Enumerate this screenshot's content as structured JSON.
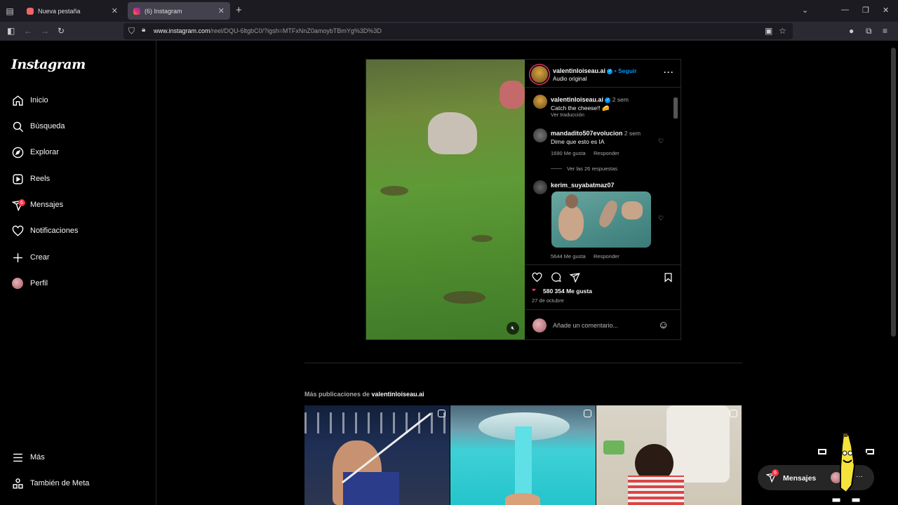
{
  "browser": {
    "tabs": [
      {
        "title": "Nueva pestaña",
        "active": false
      },
      {
        "title": "(6) Instagram",
        "active": true
      }
    ],
    "url_domain": "www.instagram.com",
    "url_path": "/reel/DQU-6ltgbC0/?igsh=MTFxNnZ0amoybTBmYg%3D%3D"
  },
  "sidebar": {
    "logo": "Instagram",
    "items": [
      {
        "label": "Inicio",
        "icon": "home-icon"
      },
      {
        "label": "Búsqueda",
        "icon": "search-icon"
      },
      {
        "label": "Explorar",
        "icon": "explore-compass-icon"
      },
      {
        "label": "Reels",
        "icon": "reels-icon"
      },
      {
        "label": "Mensajes",
        "icon": "messages-icon",
        "badge": "6"
      },
      {
        "label": "Notificaciones",
        "icon": "heart-icon"
      },
      {
        "label": "Crear",
        "icon": "plus-icon"
      },
      {
        "label": "Perfil",
        "icon": "profile-avatar"
      }
    ],
    "bottom": [
      {
        "label": "Más",
        "icon": "menu-icon"
      },
      {
        "label": "También de Meta",
        "icon": "meta-icon"
      }
    ]
  },
  "post": {
    "author": "valentinloiseau.ai",
    "separator": "•",
    "follow": "Seguir",
    "audio": "Audio original",
    "caption": {
      "user": "valentinloiseau.ai",
      "time": "2 sem",
      "text": "Catch the cheese!! 🧀",
      "translate": "Ver traducción"
    },
    "comments": [
      {
        "user": "mandadito507evolucion",
        "time": "2 sem",
        "text": "Dime que esto es IA",
        "likes": "1690 Me gusta",
        "reply": "Responder",
        "replies": "Ver las 26 respuestas"
      },
      {
        "user": "kerim_suyabatmaz07",
        "likes": "5644 Me gusta",
        "reply": "Responder"
      }
    ],
    "likes": "580 354 Me gusta",
    "date": "27 de octubre",
    "add_comment_placeholder": "Añade un comentario..."
  },
  "more": {
    "prefix": "Más publicaciones de",
    "user": "valentinloiseau.ai"
  },
  "messages_pill": {
    "label": "Mensajes",
    "badge": "6"
  },
  "colors": {
    "accent": "#0095f6",
    "badge": "#ff3040",
    "background": "#000000"
  }
}
